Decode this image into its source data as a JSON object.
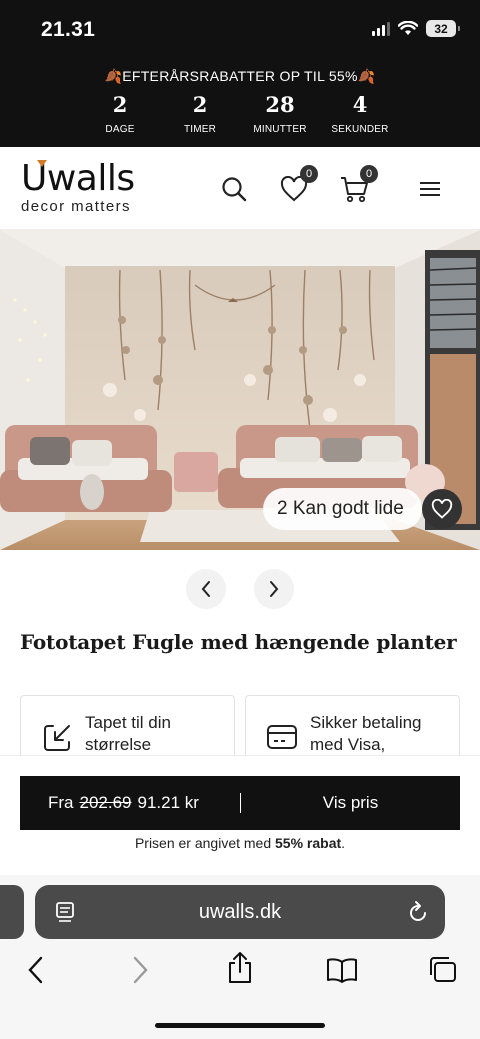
{
  "status_bar": {
    "time": "21.31",
    "battery": "32"
  },
  "promo": {
    "title": "EFTERÅRSRABATTER OP TIL 55%",
    "countdown": [
      {
        "value": "2",
        "label": "DAGE"
      },
      {
        "value": "2",
        "label": "TIMER"
      },
      {
        "value": "28",
        "label": "MINUTTER"
      },
      {
        "value": "4",
        "label": "SEKUNDER"
      }
    ]
  },
  "header": {
    "logo_main": "walls",
    "logo_letter": "U",
    "logo_sub": "decor matters",
    "wishlist_count": "0",
    "cart_count": "0",
    "icons": [
      "search-icon",
      "heart-icon",
      "cart-icon",
      "menu-icon"
    ]
  },
  "hero": {
    "likes_label": "2 Kan godt lide"
  },
  "product": {
    "title": "Fototapet Fugle med hængende planter o..."
  },
  "features": [
    {
      "icon": "resize-icon",
      "text": "Tapet til din størrelse"
    },
    {
      "icon": "card-icon",
      "text": "Sikker betaling med Visa, Mastercard"
    }
  ],
  "price_bar": {
    "prefix": "Fra",
    "old_price": "202.69",
    "new_price": "91.21 kr",
    "cta": "Vis pris"
  },
  "discount_note": {
    "text": "Prisen er angivet med ",
    "bold": "55% rabat",
    "suffix": "."
  },
  "browser": {
    "url": "uwalls.dk"
  },
  "colors": {
    "accent_leaf": "#d07a2a",
    "dark": "#111111"
  }
}
